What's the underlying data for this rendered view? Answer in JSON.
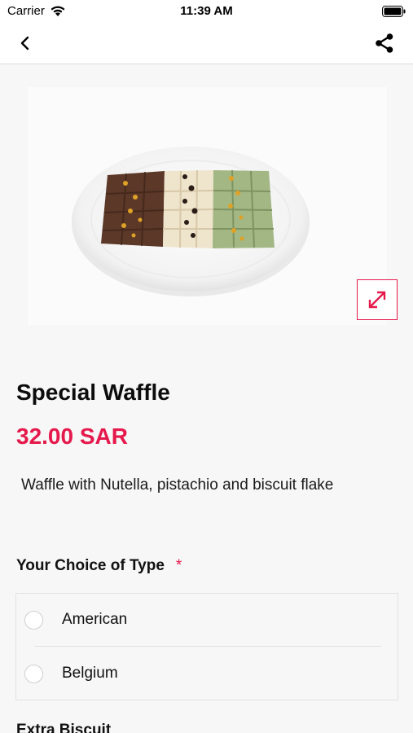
{
  "status_bar": {
    "carrier": "Carrier",
    "time": "11:39 AM"
  },
  "nav": {
    "back_icon": "chevron-left-icon",
    "share_icon": "share-icon"
  },
  "product": {
    "image_alt": "waffle-plate",
    "expand_icon": "expand-icon",
    "title": "Special Waffle",
    "price": "32.00 SAR",
    "description": "Waffle with Nutella, pistachio and biscuit flake"
  },
  "type_section": {
    "title": "Your Choice of Type",
    "required_mark": "*",
    "options": [
      {
        "label": "American",
        "selected": false
      },
      {
        "label": "Belgium",
        "selected": false
      }
    ]
  },
  "next_section": {
    "title": "Extra Biscuit"
  },
  "colors": {
    "accent": "#e5194c",
    "background": "#f7f7f7"
  }
}
